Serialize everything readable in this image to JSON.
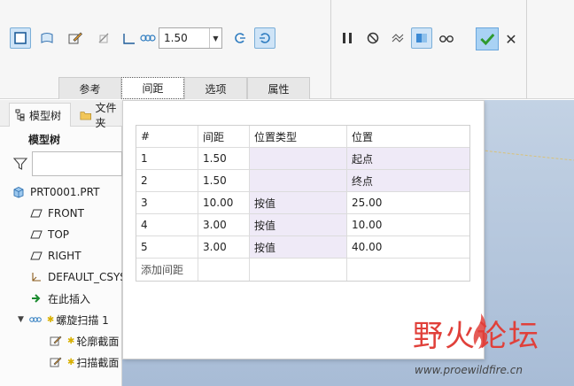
{
  "ribbon": {
    "pitch_value": "1.50"
  },
  "tabs": [
    {
      "label": "参考"
    },
    {
      "label": "间距"
    },
    {
      "label": "选项"
    },
    {
      "label": "属性"
    }
  ],
  "model_tree": {
    "tab_label": "模型树",
    "other_tab_label": "文件夹",
    "heading": "模型树",
    "filter_value": "",
    "items": [
      {
        "label": "PRT0001.PRT",
        "icon": "part-icon"
      },
      {
        "label": "FRONT",
        "icon": "datum-plane-icon"
      },
      {
        "label": "TOP",
        "icon": "datum-plane-icon"
      },
      {
        "label": "RIGHT",
        "icon": "datum-plane-icon"
      },
      {
        "label": "DEFAULT_CSYS",
        "icon": "csys-icon"
      },
      {
        "label": "在此插入",
        "icon": "insert-here-icon"
      },
      {
        "label": "螺旋扫描 1",
        "icon": "helical-sweep-icon"
      },
      {
        "label": "轮廓截面",
        "icon": "sketch-icon"
      },
      {
        "label": "扫描截面",
        "icon": "sketch-icon"
      }
    ]
  },
  "pitch_table": {
    "headers": [
      "#",
      "间距",
      "位置类型",
      "位置"
    ],
    "rows": [
      [
        "1",
        "1.50",
        "",
        "起点"
      ],
      [
        "2",
        "1.50",
        "",
        "终点"
      ],
      [
        "3",
        "10.00",
        "按值",
        "25.00"
      ],
      [
        "4",
        "3.00",
        "按值",
        "10.00"
      ],
      [
        "5",
        "3.00",
        "按值",
        "40.00"
      ]
    ],
    "add_row_label": "添加间距"
  },
  "watermark": {
    "title": "野火论坛",
    "url": "www.proewildfire.cn"
  },
  "colors": {
    "ok_accent": "#2e9a2e",
    "watermark_red": "#e0403a",
    "lavender_cell": "#efeaf7"
  }
}
